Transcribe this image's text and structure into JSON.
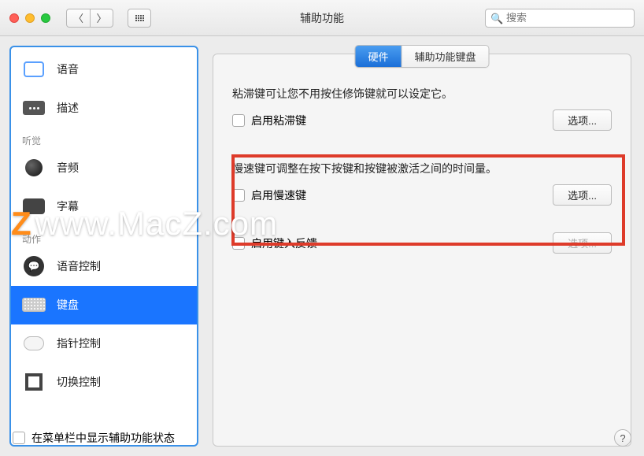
{
  "window": {
    "title": "辅助功能"
  },
  "search": {
    "placeholder": "搜索"
  },
  "sidebar": {
    "section_hear": "听觉",
    "section_motor": "动作",
    "items": {
      "speech": "语音",
      "describe": "描述",
      "audio": "音频",
      "subtitle": "字幕",
      "voicecontrol": "语音控制",
      "keyboard": "键盘",
      "pointer": "指针控制",
      "switch": "切换控制"
    }
  },
  "tabs": {
    "hardware": "硬件",
    "a11y_keyboard": "辅助功能键盘"
  },
  "sticky": {
    "desc": "粘滞键可让您不用按住修饰键就可以设定它。",
    "enable": "启用粘滞键",
    "options": "选项..."
  },
  "slow": {
    "desc": "慢速键可调整在按下按键和按键被激活之间的时间量。",
    "enable": "启用慢速键",
    "options": "选项..."
  },
  "typing": {
    "enable": "启用键入反馈",
    "options": "选项..."
  },
  "footer": {
    "menubar_checkbox": "在菜单栏中显示辅助功能状态"
  },
  "watermark": "www.MacZ.com"
}
